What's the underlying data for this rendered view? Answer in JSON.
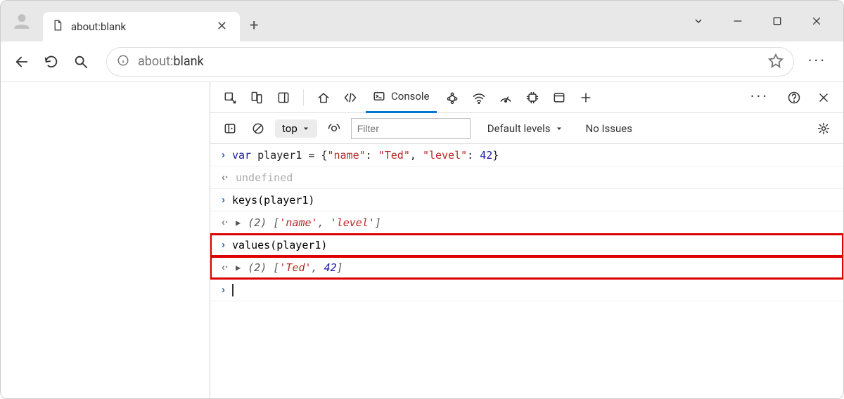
{
  "tab": {
    "title": "about:blank"
  },
  "omnibox": {
    "prefix": "about:",
    "suffix": "blank"
  },
  "devtools_tabs": {
    "active": "Console"
  },
  "filterbar": {
    "context": "top",
    "filter_placeholder": "Filter",
    "levels": "Default levels",
    "issues": "No Issues"
  },
  "console": {
    "line1_kw": "var",
    "line1_assign": " player1 = {",
    "line1_key1": "\"name\"",
    "line1_sep1": ": ",
    "line1_val1": "\"Ted\"",
    "line1_sep2": ", ",
    "line1_key2": "\"level\"",
    "line1_sep3": ": ",
    "line1_val2": "42",
    "line1_close": "}",
    "line2": "undefined",
    "line3": "keys(player1)",
    "line4_count": "(2) ",
    "line4_open": "[",
    "line4_v1": "'name'",
    "line4_sep": ", ",
    "line4_v2": "'level'",
    "line4_close": "]",
    "line5": "values(player1)",
    "line6_count": "(2) ",
    "line6_open": "[",
    "line6_v1": "'Ted'",
    "line6_sep": ", ",
    "line6_v2": "42",
    "line6_close": "]"
  }
}
